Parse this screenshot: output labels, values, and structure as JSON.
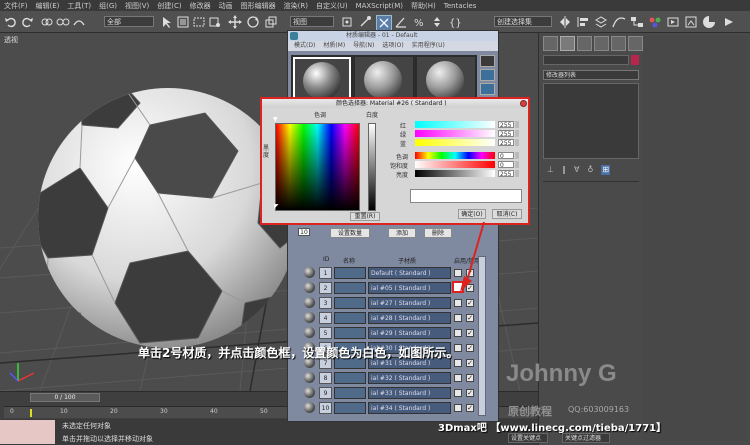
{
  "menubar": [
    "文件(F)",
    "编辑(E)",
    "工具(T)",
    "组(G)",
    "视图(V)",
    "创建(C)",
    "修改器",
    "动画",
    "图形编辑器",
    "渲染(R)",
    "自定义(U)",
    "MAXScript(M)",
    "帮助(H)",
    "Tentacles"
  ],
  "toolbar": {
    "selection_filter": "全部",
    "ref_coord": "视图",
    "named_selection": "创建选择集"
  },
  "viewport": {
    "label": "透视"
  },
  "cmdpanel": {
    "modifier_list": "修改器列表"
  },
  "material_editor": {
    "title": "材质编辑器 - 01 - Default",
    "menu": [
      "模式(D)",
      "材质(M)",
      "导航(N)",
      "选项(O)",
      "实用程序(U)"
    ],
    "set_count_value": "10",
    "set_count_label": "设置数量",
    "add_label": "添加",
    "delete_label": "删除",
    "columns": [
      "ID",
      "名称",
      "子材质",
      "启用/禁用"
    ],
    "rows": [
      {
        "id": "1",
        "sub": "Default  ( Standard )"
      },
      {
        "id": "2",
        "sub": "ial #05  ( Standard )"
      },
      {
        "id": "3",
        "sub": "ial #27  ( Standard )"
      },
      {
        "id": "4",
        "sub": "ial #28  ( Standard )"
      },
      {
        "id": "5",
        "sub": "ial #29  ( Standard )"
      },
      {
        "id": "6",
        "sub": "ial #30  ( Standard )"
      },
      {
        "id": "7",
        "sub": "ial #31  ( Standard )"
      },
      {
        "id": "8",
        "sub": "ial #32  ( Standard )"
      },
      {
        "id": "9",
        "sub": "ial #33  ( Standard )"
      },
      {
        "id": "10",
        "sub": "ial #34  ( Standard )"
      }
    ]
  },
  "color_picker": {
    "title": "颜色选择器: Material #26  ( Standard )",
    "hue_label": "色调",
    "whiteness_label": "白度",
    "blackness_label": "黑度",
    "red_label": "红",
    "green_label": "绿",
    "blue_label": "蓝",
    "hue2_label": "色调",
    "saturation_label": "饱和度",
    "value_label": "亮度",
    "red_value": "255",
    "green_value": "255",
    "blue_value": "255",
    "hue_value": "0",
    "sat_value": "0",
    "val_value": "255",
    "reset_label": "重置(R)",
    "ok_label": "确定(O)",
    "cancel_label": "取消(C)",
    "current_color": "#ffffff"
  },
  "caption": "单击2号材质，并点击颜色框，设置颜色为白色，如图所示。",
  "watermark": {
    "name": "Johnny G",
    "subtitle": "原创教程",
    "qq": "QQ:603009163",
    "site": "3Dmax吧 【www.linecg.com/tieba/1771】"
  },
  "timeline": {
    "counter": "0 / 100",
    "ticks": [
      "0",
      "10",
      "20",
      "30",
      "40",
      "50"
    ]
  },
  "status": {
    "line1": "未选定任何对象",
    "line2": "单击并拖动以选择并移动对象",
    "setkey": "设置关键点",
    "keyfilter": "关键点过滤器"
  },
  "colors": {
    "accent_red": "#dd2222",
    "ui_dark": "#3a3a3a"
  }
}
